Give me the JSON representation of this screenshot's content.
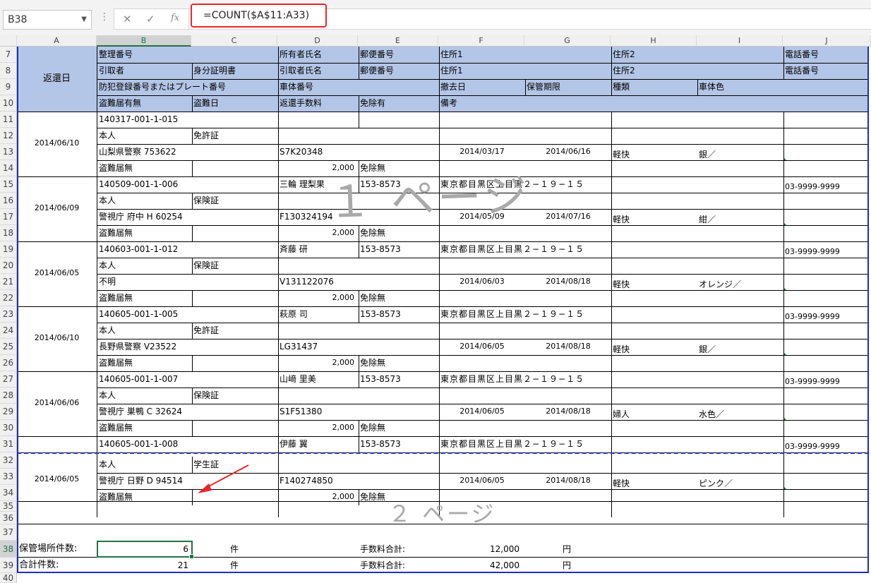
{
  "formula_bar": {
    "name_box": "B38",
    "formula": "=COUNT($A$11:A33)"
  },
  "columns": [
    "A",
    "B",
    "C",
    "D",
    "E",
    "F",
    "G",
    "H",
    "I",
    "J"
  ],
  "rows": [
    "7",
    "8",
    "9",
    "10",
    "11",
    "12",
    "13",
    "14",
    "15",
    "16",
    "17",
    "18",
    "19",
    "20",
    "21",
    "22",
    "23",
    "24",
    "25",
    "26",
    "27",
    "28",
    "29",
    "30",
    "31",
    "32",
    "33",
    "34",
    "35",
    "36",
    "37",
    "38",
    "39",
    "40"
  ],
  "header_labels": {
    "h7": [
      "整理番号",
      "所有者氏名",
      "郵便番号",
      "住所1",
      "住所2",
      "電話番号"
    ],
    "h8": [
      "引取者",
      "身分証明書",
      "引取者氏名",
      "郵便番号",
      "住所1",
      "住所2",
      "電話番号"
    ],
    "h9": [
      "防犯登録番号またはプレート番号",
      "車体番号",
      "撤去日",
      "保管期限",
      "種類",
      "車体色"
    ],
    "h10": [
      "盗難届有無",
      "盗難日",
      "返還手数料",
      "免除有",
      "備考"
    ],
    "henkanbi": "返還日"
  },
  "records": [
    {
      "date": "2014/06/10",
      "id": "140317-001-1-015",
      "owner": "",
      "zip": "",
      "addr": "",
      "phone": "",
      "taker": "本人",
      "cert": "免許証",
      "reg": "山梨県警察 753622",
      "serial": "S7K20348",
      "removed": "2014/03/17",
      "deadline": "2014/06/16",
      "kind": "軽快",
      "color": "銀／",
      "theft": "盗難届無",
      "fee": "2,000",
      "exempt": "免除無"
    },
    {
      "date": "2014/06/09",
      "id": "140509-001-1-006",
      "owner": "三輪 理梨果",
      "zip": "153-8573",
      "addr": "東京都目黒区上目黒２−１９−１５",
      "phone": "03-9999-9999",
      "taker": "本人",
      "cert": "保険証",
      "reg": "警視庁 府中 H 60254",
      "serial": "F130324194",
      "removed": "2014/05/09",
      "deadline": "2014/07/16",
      "kind": "軽快",
      "color": "紺／",
      "theft": "盗難届無",
      "fee": "2,000",
      "exempt": "免除無"
    },
    {
      "date": "2014/06/05",
      "id": "140603-001-1-012",
      "owner": "斉藤 研",
      "zip": "153-8573",
      "addr": "東京都目黒区上目黒２−１９−１５",
      "phone": "03-9999-9999",
      "taker": "本人",
      "cert": "保険証",
      "reg": "不明",
      "serial": "V131122076",
      "removed": "2014/06/03",
      "deadline": "2014/08/18",
      "kind": "軽快",
      "color": "オレンジ／",
      "theft": "盗難届無",
      "fee": "2,000",
      "exempt": "免除無"
    },
    {
      "date": "2014/06/10",
      "id": "140605-001-1-005",
      "owner": "萩原 司",
      "zip": "153-8573",
      "addr": "東京都目黒区上目黒２−１９−１５",
      "phone": "03-9999-9999",
      "taker": "本人",
      "cert": "免許証",
      "reg": "長野県警察 V23522",
      "serial": "LG31437",
      "removed": "2014/06/05",
      "deadline": "2014/08/18",
      "kind": "軽快",
      "color": "銀／",
      "theft": "盗難届無",
      "fee": "2,000",
      "exempt": "免除無"
    },
    {
      "date": "2014/06/06",
      "id": "140605-001-1-007",
      "owner": "山﨑 里美",
      "zip": "153-8573",
      "addr": "東京都目黒区上目黒２−１９−１５",
      "phone": "03-9999-9999",
      "taker": "本人",
      "cert": "保険証",
      "reg": "警視庁 巣鴨 C 32624",
      "serial": "S1F51380",
      "removed": "2014/06/05",
      "deadline": "2014/08/18",
      "kind": "婦人",
      "color": "水色／",
      "theft": "盗難届無",
      "fee": "2,000",
      "exempt": "免除無"
    },
    {
      "date": "2014/06/05",
      "id": "140605-001-1-008",
      "owner": "伊藤 翼",
      "zip": "153-8573",
      "addr": "東京都目黒区上目黒２−１９−１５",
      "phone": "03-9999-9999",
      "taker": "本人",
      "cert": "学生証",
      "reg": "警視庁 日野 D 94514",
      "serial": "F140274850",
      "removed": "2014/06/05",
      "deadline": "2014/08/18",
      "kind": "軽快",
      "color": "ピンク／",
      "theft": "盗難届無",
      "fee": "2,000",
      "exempt": "免除無"
    }
  ],
  "watermarks": {
    "page1": "１ ページ",
    "page2": "２ ページ"
  },
  "summary": {
    "label1": "保管場所件数:",
    "value1": "6",
    "unit1": "件",
    "feelabel1": "手数料合計:",
    "fee1": "12,000",
    "yen1": "円",
    "label2": "合計件数:",
    "value2": "21",
    "unit2": "件",
    "feelabel2": "手数料合計:",
    "fee2": "42,000",
    "yen2": "円"
  },
  "colors": {
    "header_fill": "#b4c6e7",
    "page_break": "#1c2fb8",
    "selection": "#217346",
    "formula_highlight": "#e8262b"
  }
}
